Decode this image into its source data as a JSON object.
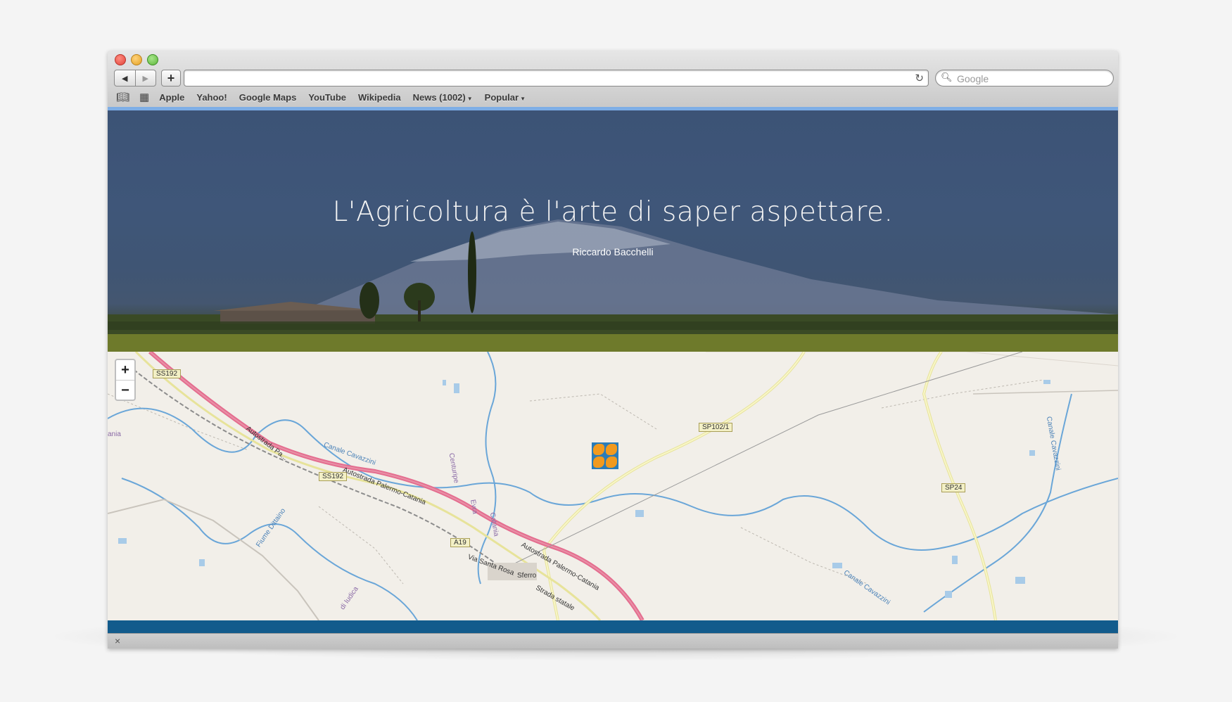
{
  "browser": {
    "search_placeholder": "Google",
    "bookmarks": [
      "Apple",
      "Yahoo!",
      "Google Maps",
      "YouTube",
      "Wikipedia",
      "News (1002)",
      "Popular"
    ]
  },
  "hero": {
    "quote": "L'Agricoltura è l'arte di saper aspettare.",
    "author": "Riccardo Bacchelli"
  },
  "map": {
    "zoom_in": "+",
    "zoom_out": "−",
    "labels": {
      "ss192_a": "SS192",
      "ss192_b": "SS192",
      "sp102": "SP102/1",
      "sp24": "SP24",
      "a19": "A19",
      "autostrada_a": "Autostrada Pa...",
      "autostrada_b": "Autostrada Palermo-Catania",
      "autostrada_c": "Autostrada Palermo-Catania",
      "canale_a": "Canale Cavazzini",
      "canale_b": "Canale Cavazzini",
      "canale_c": "Canale Cavazzini",
      "fiume": "Fiume Dittaino",
      "centuripe": "Centuripe",
      "sferro": "Sferro",
      "via_santa_rosa": "Via Santa Rosa",
      "strada_statale": "Strada statale",
      "evra": "Evra",
      "catania": "Catania",
      "iudica": "di Iudica",
      "nia": "ania"
    }
  },
  "status": {
    "close_glyph": "×"
  }
}
